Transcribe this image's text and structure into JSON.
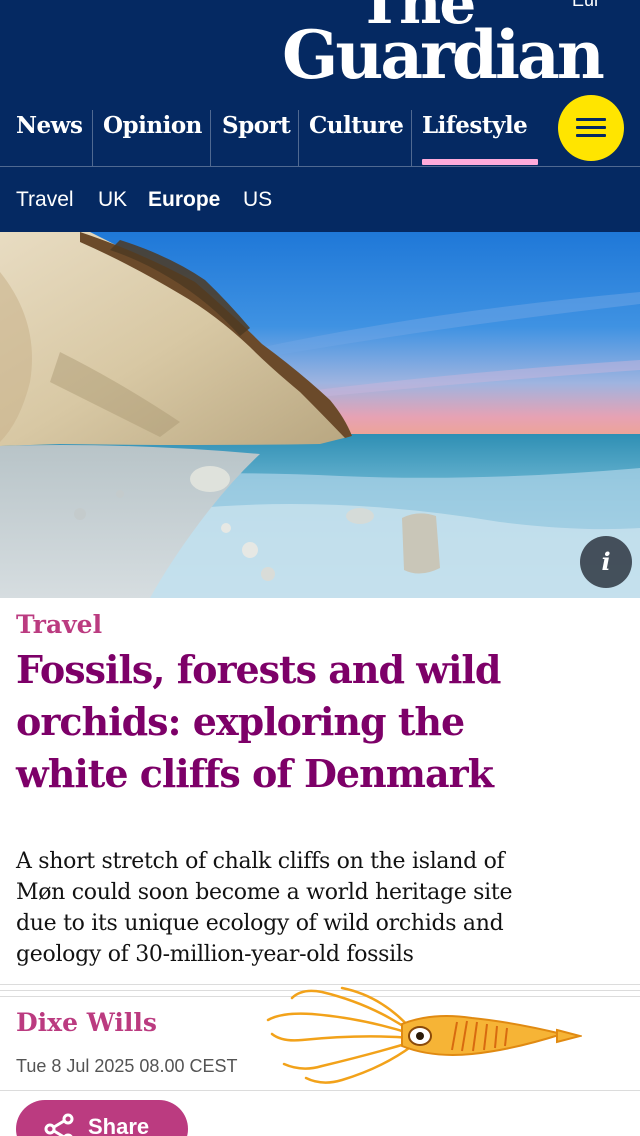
{
  "masthead": {
    "logo_line1": "The",
    "logo_line2": "Guardian",
    "edition": "Eur",
    "menu_icon": "hamburger-menu-icon"
  },
  "pillars": [
    {
      "label": "News"
    },
    {
      "label": "Opinion"
    },
    {
      "label": "Sport"
    },
    {
      "label": "Culture"
    },
    {
      "label": "Lifestyle",
      "active": true
    }
  ],
  "subnav": [
    {
      "label": "Travel"
    },
    {
      "label": "UK"
    },
    {
      "label": "Europe",
      "active": true
    },
    {
      "label": "US"
    }
  ],
  "hero": {
    "info_label": "i"
  },
  "article": {
    "kicker": "Travel",
    "headline_lines": [
      "Fossils, forests and wild",
      "orchids: exploring the",
      "white cliffs of Denmark"
    ],
    "standfirst_lines": [
      "A short stretch of chalk cliffs on the island of",
      "Møn could soon become a world heritage site",
      "due to its unique ecology of wild orchids and",
      "geology of 30-million-year-old fossils"
    ],
    "byline": "Dixe Wills",
    "dateline": "Tue 8 Jul 2025 08.00 CEST",
    "share_label": "Share",
    "share_icon": "share-icon"
  },
  "colors": {
    "brand_blue": "#052962",
    "menu_yellow": "#ffe500",
    "lifestyle_pink": "#bb3b80",
    "headline_purple": "#7d0068",
    "underline_pink": "#ffabdb"
  }
}
